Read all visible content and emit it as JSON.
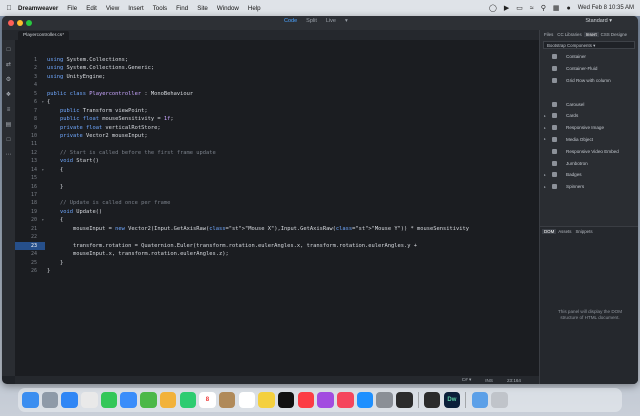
{
  "menubar": {
    "app_name": "Dreamweaver",
    "items": [
      "File",
      "Edit",
      "View",
      "Insert",
      "Tools",
      "Find",
      "Site",
      "Window",
      "Help"
    ],
    "clock": "Wed Feb 8  10:35 AM"
  },
  "window": {
    "view_modes": {
      "code": "Code",
      "split": "Split",
      "live": "Live"
    },
    "workspace": "Standard",
    "file_tab": "Playercontroller.cs*"
  },
  "editor": {
    "line_numbers": [
      "1",
      "2",
      "3",
      "4",
      "5",
      "6",
      "7",
      "8",
      "9",
      "10",
      "11",
      "12",
      "13",
      "14",
      "15",
      "16",
      "17",
      "18",
      "19",
      "20",
      "21",
      "22",
      "23",
      "24",
      "25",
      "26"
    ],
    "current_line": "23",
    "lines": [
      "using System.Collections;",
      "using System.Collections.Generic;",
      "using UnityEngine;",
      "",
      "public class Playercontroller : MonoBehaviour",
      "{",
      "    public Transform viewPoint;",
      "    public float mouseSensitivity = 1f;",
      "    private float verticalRotStore;",
      "    private Vector2 mouseInput;",
      "",
      "    // Start is called before the first frame update",
      "    void Start()",
      "    {",
      "",
      "    }",
      "",
      "    // Update is called once per frame",
      "    void Update()",
      "    {",
      "        mouseInput = new Vector2(Input.GetAxisRaw(\"Mouse X\"),Input.GetAxisRaw(\"Mouse Y\")) * mouseSensitivity",
      "",
      "        transform.rotation = Quaternion.Euler(transform.rotation.eulerAngles.x, transform.rotation.eulerAngles.y +",
      "        mouseInput.x, transform.rotation.eulerAngles.z);",
      "    }",
      "}"
    ]
  },
  "status": {
    "language": "C#",
    "mode": "INS",
    "position": "23:164"
  },
  "panel": {
    "tabs": [
      "Files",
      "CC Libraries",
      "Insert",
      "CSS Designe"
    ],
    "active_tab": "Insert",
    "bootstrap_dropdown": "Bootstrap Components",
    "components": [
      "Container",
      "Container-Fluid",
      "Grid Row with column",
      "",
      "Carousel",
      "Cards",
      "Responsive Image",
      "Media Object",
      "Responsive Video Embed",
      "Jumbotron",
      "Badges",
      "Spinners"
    ],
    "dom_tabs": [
      "DOM",
      "Assets",
      "Snippets"
    ],
    "dom_message": "This panel will display the DOM structure of HTML document."
  },
  "dock": {
    "apps": [
      "finder",
      "launchpad",
      "safari",
      "chrome",
      "messages",
      "mail",
      "maps",
      "photos",
      "facetime",
      "calendar",
      "contacts",
      "reminders",
      "notes",
      "tv",
      "music",
      "podcasts",
      "news",
      "app-store",
      "system-preferences",
      "unity-hub",
      "unity",
      "dreamweaver",
      "downloads",
      "trash"
    ],
    "calendar_day": "8",
    "dreamweaver_label": "Dw"
  }
}
